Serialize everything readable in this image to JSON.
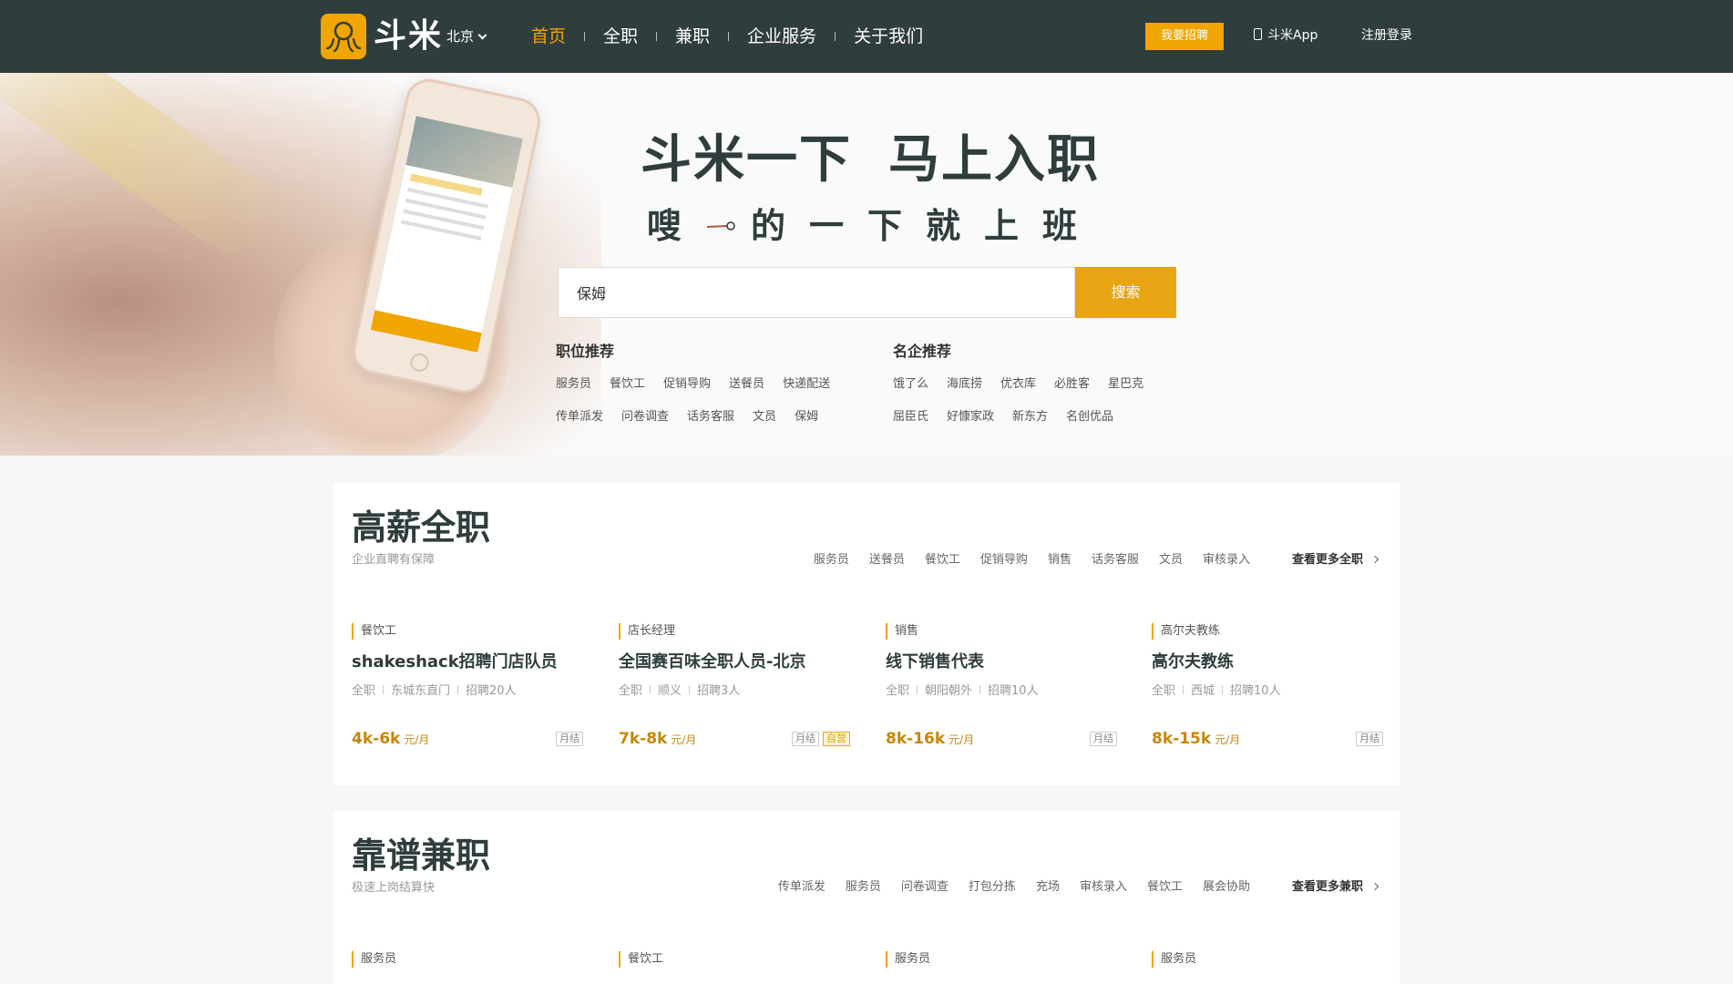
{
  "brand": {
    "name": "斗米",
    "logo_color": "#f0a500"
  },
  "city": "北京",
  "nav": [
    "首页",
    "全职",
    "兼职",
    "企业服务",
    "关于我们"
  ],
  "header_actions": {
    "recruit": "我要招聘",
    "app": "斗米App",
    "login": "注册登录"
  },
  "hero": {
    "slogan_a": "斗米一下",
    "slogan_b": "马上入职",
    "slogan_c1": "嗖",
    "slogan_c2": "的一下就上班",
    "search_value": "保姆",
    "search_button": "搜索",
    "job_rec": {
      "title": "职位推荐",
      "row1": [
        "服务员",
        "餐饮工",
        "促销导购",
        "送餐员",
        "快递配送"
      ],
      "row2": [
        "传单派发",
        "问卷调查",
        "话务客服",
        "文员",
        "保姆"
      ]
    },
    "company_rec": {
      "title": "名企推荐",
      "row1": [
        "饿了么",
        "海底捞",
        "优衣库",
        "必胜客",
        "星巴克"
      ],
      "row2": [
        "屈臣氏",
        "好慷家政",
        "新东方",
        "名创优品"
      ]
    }
  },
  "fulltime": {
    "title": "高薪全职",
    "subtitle": "企业直聘有保障",
    "tags": [
      "服务员",
      "送餐员",
      "餐饮工",
      "促销导购",
      "销售",
      "话务客服",
      "文员",
      "审核录入"
    ],
    "more": "查看更多全职",
    "cards": [
      {
        "category": "餐饮工",
        "title": "shakeshack招聘门店队员",
        "type": "全职",
        "area": "东城东直门",
        "hire": "招聘20人",
        "salary": "4k-6k",
        "unit": "元/月",
        "badges": [
          "月结"
        ]
      },
      {
        "category": "店长经理",
        "title": "全国赛百味全职人员-北京",
        "type": "全职",
        "area": "顺义",
        "hire": "招聘3人",
        "salary": "7k-8k",
        "unit": "元/月",
        "badges": [
          "月结",
          "自营"
        ]
      },
      {
        "category": "销售",
        "title": "线下销售代表",
        "type": "全职",
        "area": "朝阳朝外",
        "hire": "招聘10人",
        "salary": "8k-16k",
        "unit": "元/月",
        "badges": [
          "月结"
        ]
      },
      {
        "category": "高尔夫教练",
        "title": "高尔夫教练",
        "type": "全职",
        "area": "西城",
        "hire": "招聘10人",
        "salary": "8k-15k",
        "unit": "元/月",
        "badges": [
          "月结"
        ]
      }
    ]
  },
  "parttime": {
    "title": "靠谱兼职",
    "subtitle": "极速上岗结算快",
    "tags": [
      "传单派发",
      "服务员",
      "问卷调查",
      "打包分拣",
      "充场",
      "审核录入",
      "餐饮工",
      "展会协助"
    ],
    "more": "查看更多兼职",
    "card_categories": [
      "服务员",
      "餐饮工",
      "服务员",
      "服务员"
    ]
  }
}
